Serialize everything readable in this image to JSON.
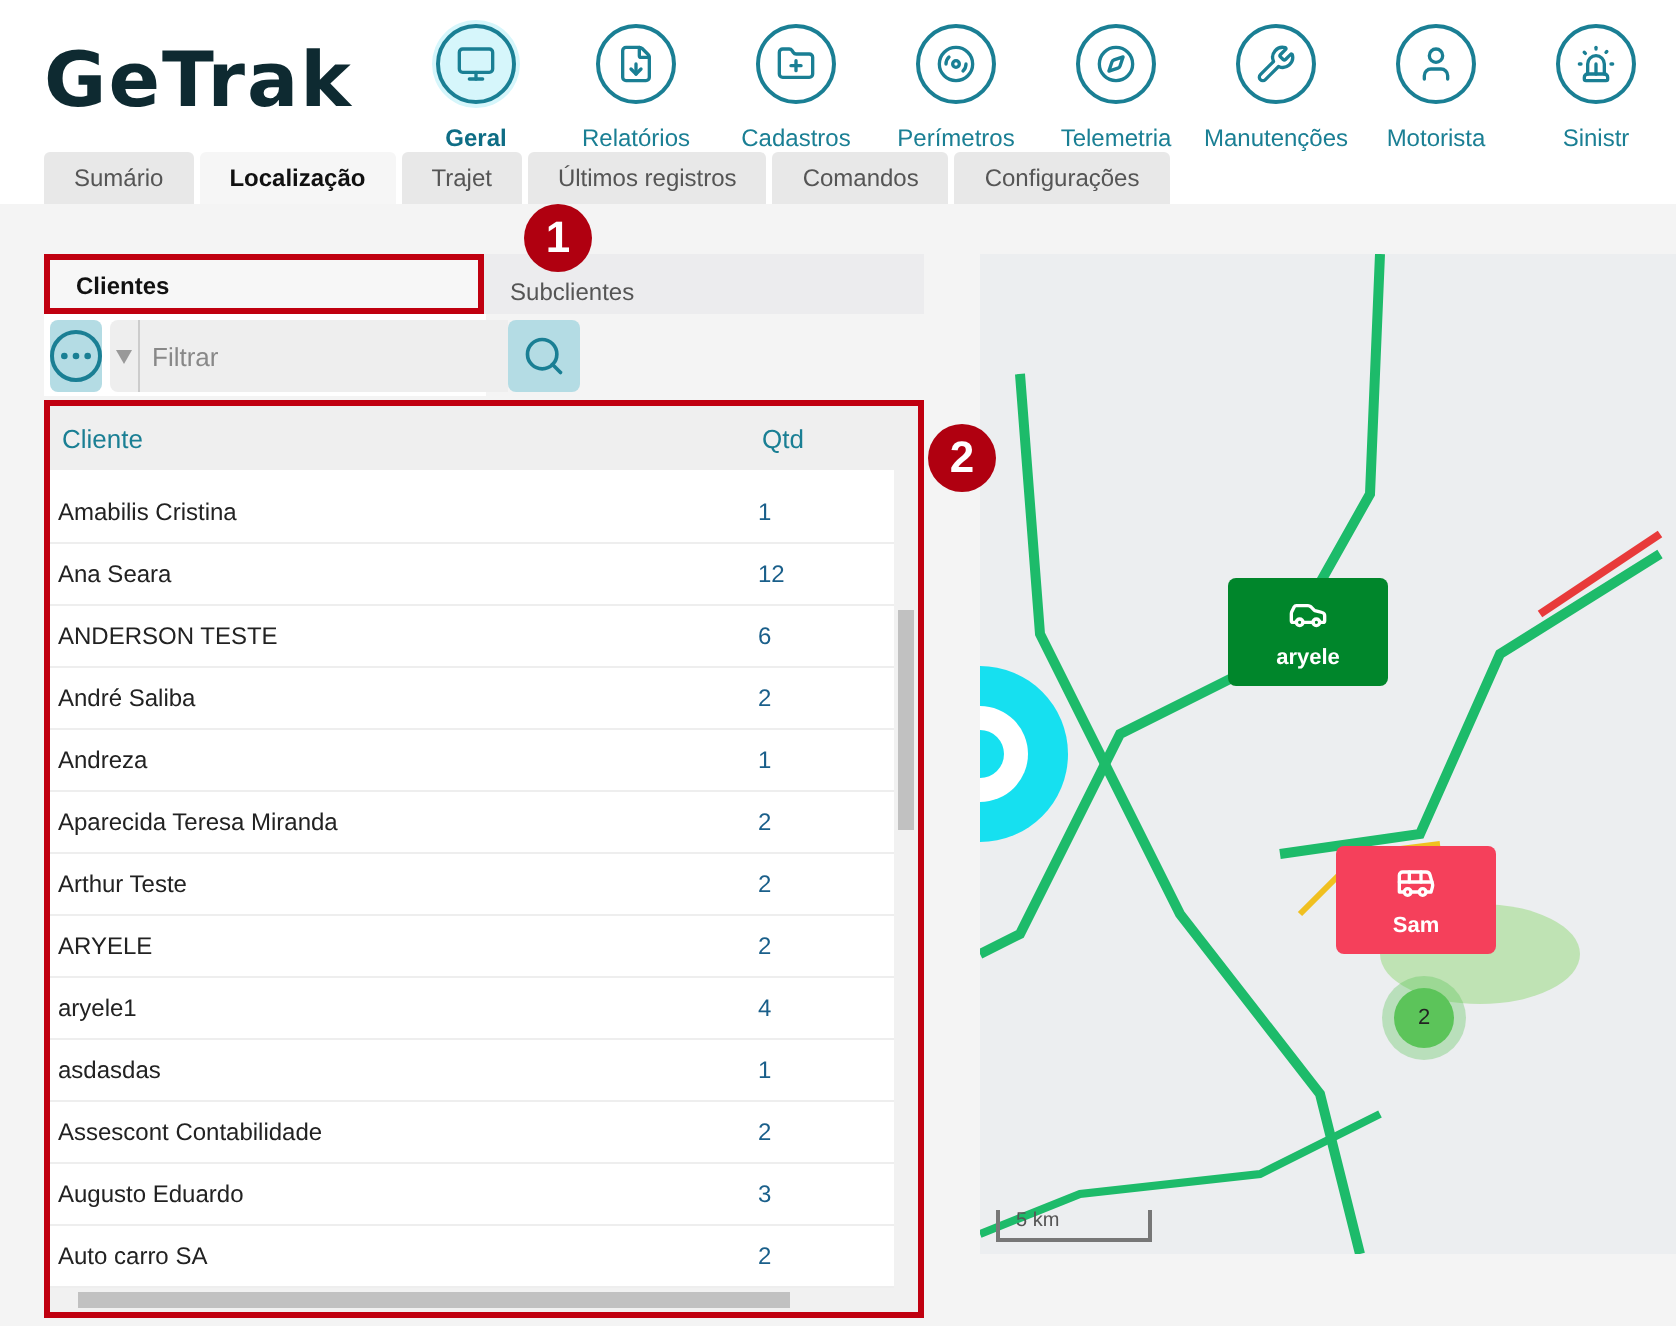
{
  "logo": "GeTrak",
  "nav": [
    {
      "label": "Geral",
      "selected": true
    },
    {
      "label": "Relatórios",
      "selected": false
    },
    {
      "label": "Cadastros",
      "selected": false
    },
    {
      "label": "Perímetros",
      "selected": false
    },
    {
      "label": "Telemetria",
      "selected": false
    },
    {
      "label": "Manutenções",
      "selected": false
    },
    {
      "label": "Motorista",
      "selected": false
    },
    {
      "label": "Sinistr",
      "selected": false
    }
  ],
  "tabs": [
    {
      "label": "Sumário",
      "selected": false
    },
    {
      "label": "Localização",
      "selected": true
    },
    {
      "label": "Trajet",
      "selected": false
    },
    {
      "label": "Últimos registros",
      "selected": false
    },
    {
      "label": "Comandos",
      "selected": false
    },
    {
      "label": "Configurações",
      "selected": false
    }
  ],
  "annotations": [
    {
      "number": "1"
    },
    {
      "number": "2"
    }
  ],
  "subtabs": [
    {
      "label": "Clientes",
      "selected": true,
      "highlighted": true
    },
    {
      "label": "Subclientes",
      "selected": false,
      "highlighted": false
    }
  ],
  "filter": {
    "placeholder": "Filtrar"
  },
  "table": {
    "highlighted": true,
    "columns": [
      "Cliente",
      "Qtd"
    ],
    "rows": [
      [
        "Amabilis Cristina",
        "1"
      ],
      [
        "Ana Seara",
        "12"
      ],
      [
        "ANDERSON TESTE",
        "6"
      ],
      [
        "André Saliba",
        "2"
      ],
      [
        "Andreza",
        "1"
      ],
      [
        "Aparecida Teresa Miranda",
        "2"
      ],
      [
        "Arthur Teste",
        "2"
      ],
      [
        "ARYELE",
        "2"
      ],
      [
        "aryele1",
        "4"
      ],
      [
        "asdasdas",
        "1"
      ],
      [
        "Assescont Contabilidade",
        "2"
      ],
      [
        "Augusto Eduardo",
        "3"
      ],
      [
        "Auto carro SA",
        "2"
      ]
    ]
  },
  "map": {
    "markers": [
      {
        "label": "aryele",
        "color": "#00862b"
      },
      {
        "label": "Sam",
        "color": "#f5405b"
      }
    ],
    "cluster": "2",
    "scale": "5 km"
  }
}
